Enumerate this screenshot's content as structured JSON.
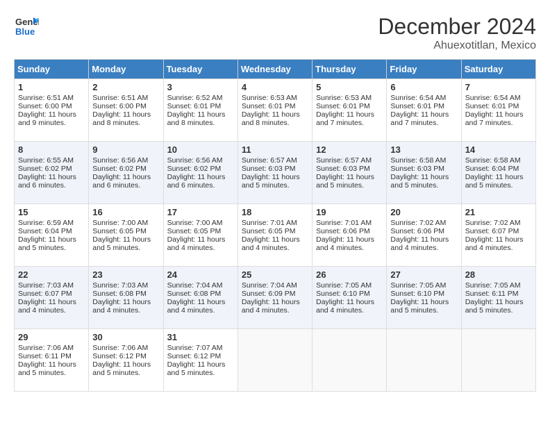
{
  "header": {
    "logo_general": "General",
    "logo_blue": "Blue",
    "month": "December 2024",
    "location": "Ahuexotitlan, Mexico"
  },
  "weekdays": [
    "Sunday",
    "Monday",
    "Tuesday",
    "Wednesday",
    "Thursday",
    "Friday",
    "Saturday"
  ],
  "weeks": [
    [
      {
        "day": "1",
        "lines": [
          "Sunrise: 6:51 AM",
          "Sunset: 6:00 PM",
          "Daylight: 11 hours",
          "and 9 minutes."
        ]
      },
      {
        "day": "2",
        "lines": [
          "Sunrise: 6:51 AM",
          "Sunset: 6:00 PM",
          "Daylight: 11 hours",
          "and 8 minutes."
        ]
      },
      {
        "day": "3",
        "lines": [
          "Sunrise: 6:52 AM",
          "Sunset: 6:01 PM",
          "Daylight: 11 hours",
          "and 8 minutes."
        ]
      },
      {
        "day": "4",
        "lines": [
          "Sunrise: 6:53 AM",
          "Sunset: 6:01 PM",
          "Daylight: 11 hours",
          "and 8 minutes."
        ]
      },
      {
        "day": "5",
        "lines": [
          "Sunrise: 6:53 AM",
          "Sunset: 6:01 PM",
          "Daylight: 11 hours",
          "and 7 minutes."
        ]
      },
      {
        "day": "6",
        "lines": [
          "Sunrise: 6:54 AM",
          "Sunset: 6:01 PM",
          "Daylight: 11 hours",
          "and 7 minutes."
        ]
      },
      {
        "day": "7",
        "lines": [
          "Sunrise: 6:54 AM",
          "Sunset: 6:01 PM",
          "Daylight: 11 hours",
          "and 7 minutes."
        ]
      }
    ],
    [
      {
        "day": "8",
        "lines": [
          "Sunrise: 6:55 AM",
          "Sunset: 6:02 PM",
          "Daylight: 11 hours",
          "and 6 minutes."
        ]
      },
      {
        "day": "9",
        "lines": [
          "Sunrise: 6:56 AM",
          "Sunset: 6:02 PM",
          "Daylight: 11 hours",
          "and 6 minutes."
        ]
      },
      {
        "day": "10",
        "lines": [
          "Sunrise: 6:56 AM",
          "Sunset: 6:02 PM",
          "Daylight: 11 hours",
          "and 6 minutes."
        ]
      },
      {
        "day": "11",
        "lines": [
          "Sunrise: 6:57 AM",
          "Sunset: 6:03 PM",
          "Daylight: 11 hours",
          "and 5 minutes."
        ]
      },
      {
        "day": "12",
        "lines": [
          "Sunrise: 6:57 AM",
          "Sunset: 6:03 PM",
          "Daylight: 11 hours",
          "and 5 minutes."
        ]
      },
      {
        "day": "13",
        "lines": [
          "Sunrise: 6:58 AM",
          "Sunset: 6:03 PM",
          "Daylight: 11 hours",
          "and 5 minutes."
        ]
      },
      {
        "day": "14",
        "lines": [
          "Sunrise: 6:58 AM",
          "Sunset: 6:04 PM",
          "Daylight: 11 hours",
          "and 5 minutes."
        ]
      }
    ],
    [
      {
        "day": "15",
        "lines": [
          "Sunrise: 6:59 AM",
          "Sunset: 6:04 PM",
          "Daylight: 11 hours",
          "and 5 minutes."
        ]
      },
      {
        "day": "16",
        "lines": [
          "Sunrise: 7:00 AM",
          "Sunset: 6:05 PM",
          "Daylight: 11 hours",
          "and 5 minutes."
        ]
      },
      {
        "day": "17",
        "lines": [
          "Sunrise: 7:00 AM",
          "Sunset: 6:05 PM",
          "Daylight: 11 hours",
          "and 4 minutes."
        ]
      },
      {
        "day": "18",
        "lines": [
          "Sunrise: 7:01 AM",
          "Sunset: 6:05 PM",
          "Daylight: 11 hours",
          "and 4 minutes."
        ]
      },
      {
        "day": "19",
        "lines": [
          "Sunrise: 7:01 AM",
          "Sunset: 6:06 PM",
          "Daylight: 11 hours",
          "and 4 minutes."
        ]
      },
      {
        "day": "20",
        "lines": [
          "Sunrise: 7:02 AM",
          "Sunset: 6:06 PM",
          "Daylight: 11 hours",
          "and 4 minutes."
        ]
      },
      {
        "day": "21",
        "lines": [
          "Sunrise: 7:02 AM",
          "Sunset: 6:07 PM",
          "Daylight: 11 hours",
          "and 4 minutes."
        ]
      }
    ],
    [
      {
        "day": "22",
        "lines": [
          "Sunrise: 7:03 AM",
          "Sunset: 6:07 PM",
          "Daylight: 11 hours",
          "and 4 minutes."
        ]
      },
      {
        "day": "23",
        "lines": [
          "Sunrise: 7:03 AM",
          "Sunset: 6:08 PM",
          "Daylight: 11 hours",
          "and 4 minutes."
        ]
      },
      {
        "day": "24",
        "lines": [
          "Sunrise: 7:04 AM",
          "Sunset: 6:08 PM",
          "Daylight: 11 hours",
          "and 4 minutes."
        ]
      },
      {
        "day": "25",
        "lines": [
          "Sunrise: 7:04 AM",
          "Sunset: 6:09 PM",
          "Daylight: 11 hours",
          "and 4 minutes."
        ]
      },
      {
        "day": "26",
        "lines": [
          "Sunrise: 7:05 AM",
          "Sunset: 6:10 PM",
          "Daylight: 11 hours",
          "and 4 minutes."
        ]
      },
      {
        "day": "27",
        "lines": [
          "Sunrise: 7:05 AM",
          "Sunset: 6:10 PM",
          "Daylight: 11 hours",
          "and 5 minutes."
        ]
      },
      {
        "day": "28",
        "lines": [
          "Sunrise: 7:05 AM",
          "Sunset: 6:11 PM",
          "Daylight: 11 hours",
          "and 5 minutes."
        ]
      }
    ],
    [
      {
        "day": "29",
        "lines": [
          "Sunrise: 7:06 AM",
          "Sunset: 6:11 PM",
          "Daylight: 11 hours",
          "and 5 minutes."
        ]
      },
      {
        "day": "30",
        "lines": [
          "Sunrise: 7:06 AM",
          "Sunset: 6:12 PM",
          "Daylight: 11 hours",
          "and 5 minutes."
        ]
      },
      {
        "day": "31",
        "lines": [
          "Sunrise: 7:07 AM",
          "Sunset: 6:12 PM",
          "Daylight: 11 hours",
          "and 5 minutes."
        ]
      },
      null,
      null,
      null,
      null
    ]
  ]
}
